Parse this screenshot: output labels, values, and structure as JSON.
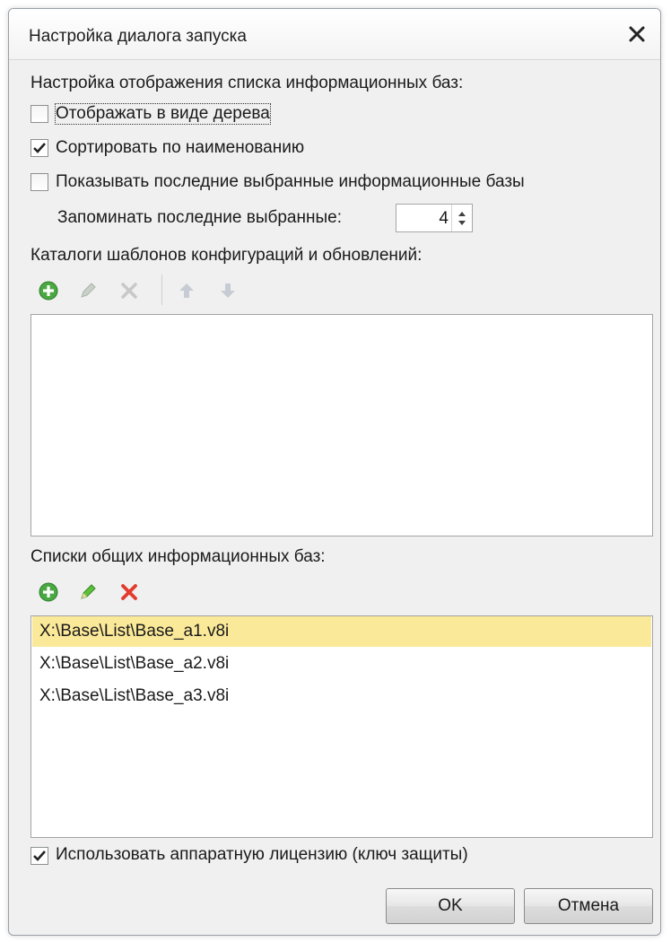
{
  "window": {
    "title": "Настройка диалога запуска"
  },
  "display_settings": {
    "heading": "Настройка отображения списка информационных баз:",
    "options": [
      {
        "label": "Отображать в виде дерева",
        "checked": false
      },
      {
        "label": "Сортировать по наименованию",
        "checked": true
      },
      {
        "label": "Показывать последние выбранные информационные базы",
        "checked": false
      }
    ],
    "remember": {
      "label": "Запоминать последние выбранные:",
      "value": "4"
    }
  },
  "templates": {
    "heading": "Каталоги шаблонов конфигураций и обновлений:",
    "toolbar": [
      "add-icon",
      "edit-icon",
      "delete-icon",
      "move-up-icon",
      "move-down-icon"
    ],
    "items": []
  },
  "shared_lists": {
    "heading": "Списки общих информационных баз:",
    "toolbar": [
      "add-icon",
      "edit-icon",
      "delete-icon"
    ],
    "items": [
      "X:\\Base\\List\\Base_a1.v8i",
      "X:\\Base\\List\\Base_a2.v8i",
      "X:\\Base\\List\\Base_a3.v8i"
    ],
    "selected_index": 0
  },
  "hardware_license": {
    "label": "Использовать аппаратную лицензию (ключ защиты)",
    "checked": true
  },
  "buttons": {
    "ok": "OK",
    "cancel": "Отмена"
  },
  "colors": {
    "selection": "#fbe99a",
    "add_green": "#3aa33a",
    "delete_red": "#e23b2e",
    "edit_green": "#4caf3a"
  }
}
